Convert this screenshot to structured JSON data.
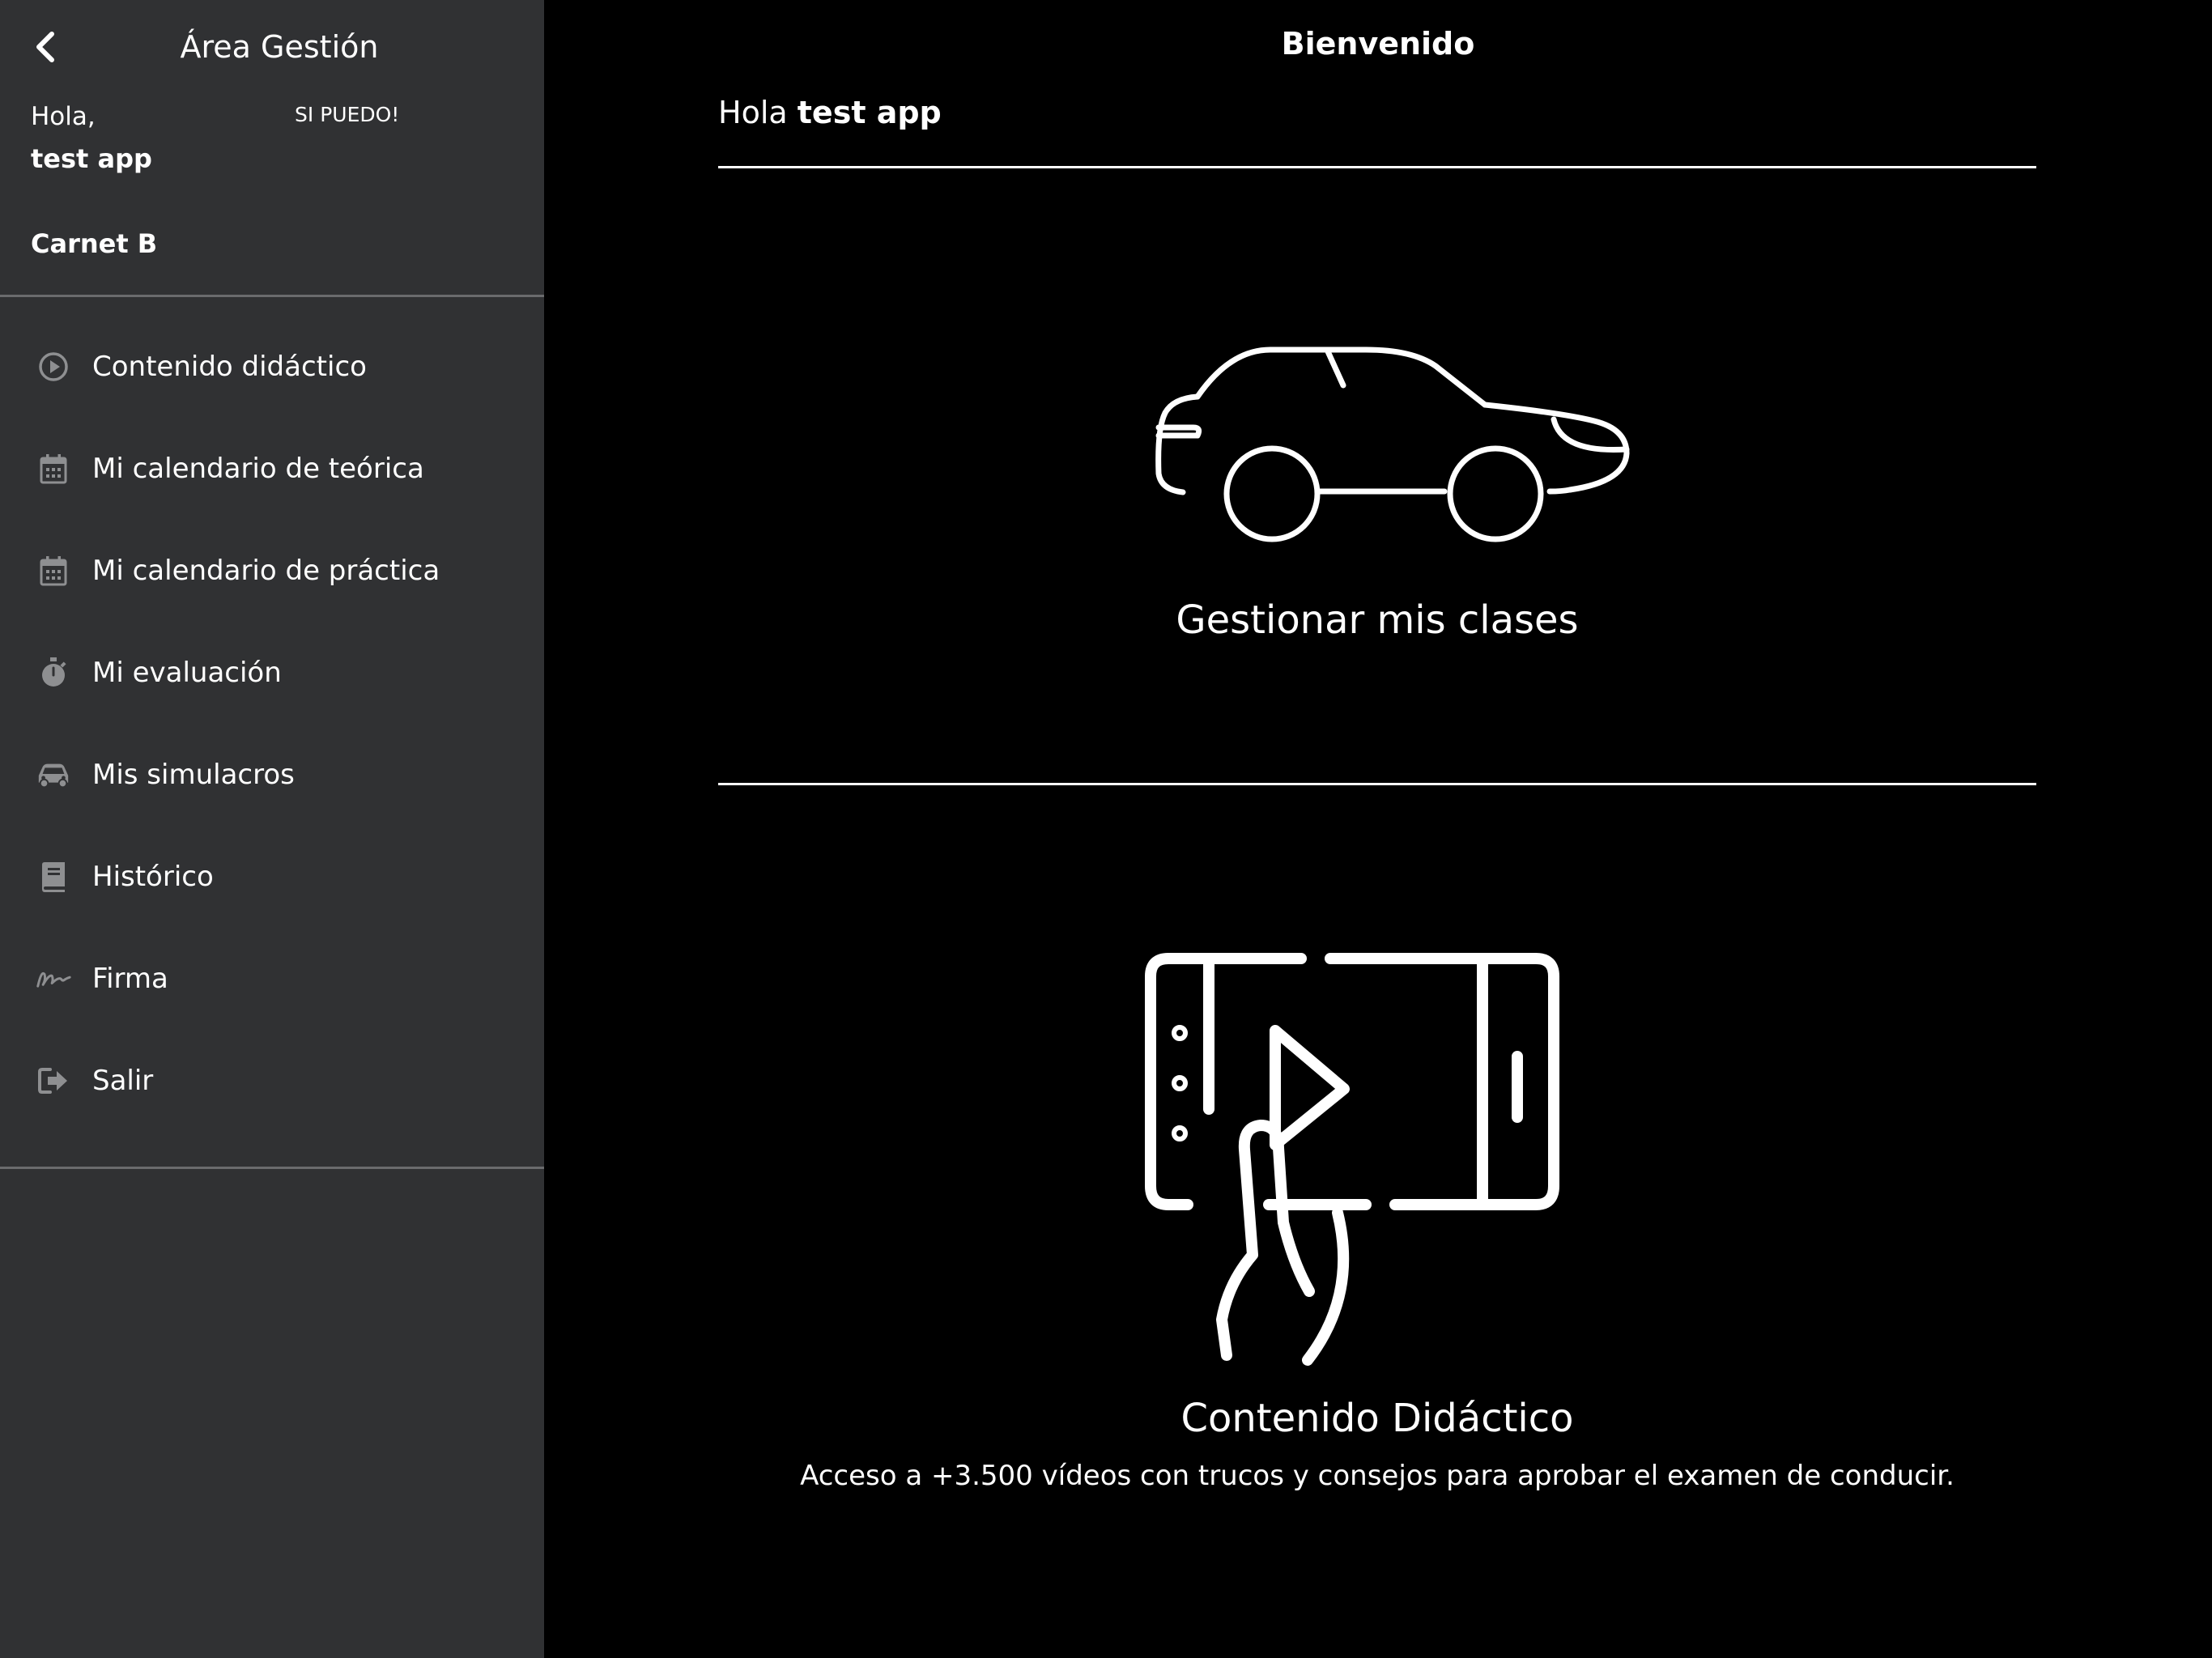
{
  "sidebar": {
    "title": "Área Gestión",
    "greeting_label": "Hola,",
    "user_name": "test app",
    "slogan": "SI PUEDO!",
    "licence": "Carnet B",
    "menu": [
      {
        "label": "Contenido didáctico",
        "icon": "play-circle-icon"
      },
      {
        "label": "Mi calendario de teórica",
        "icon": "calendar-icon"
      },
      {
        "label": "Mi calendario de práctica",
        "icon": "calendar-icon"
      },
      {
        "label": "Mi evaluación",
        "icon": "stopwatch-icon"
      },
      {
        "label": "Mis simulacros",
        "icon": "car-icon"
      },
      {
        "label": "Histórico",
        "icon": "book-icon"
      },
      {
        "label": "Firma",
        "icon": "signature-icon"
      },
      {
        "label": "Salir",
        "icon": "logout-icon"
      }
    ]
  },
  "main": {
    "title": "Bienvenido",
    "hello_prefix": "Hola",
    "hello_name": "test app",
    "cards": [
      {
        "title": "Gestionar mis clases",
        "icon": "car-outline-icon"
      },
      {
        "title": "Contenido Didáctico",
        "description": "Acceso a +3.500 vídeos con trucos y consejos para aprobar el examen de conducir.",
        "icon": "tablet-video-icon"
      }
    ]
  },
  "colors": {
    "sidebar_bg": "#303133",
    "main_bg": "#000000",
    "text": "#ffffff",
    "icon_muted": "#8e8f91"
  }
}
